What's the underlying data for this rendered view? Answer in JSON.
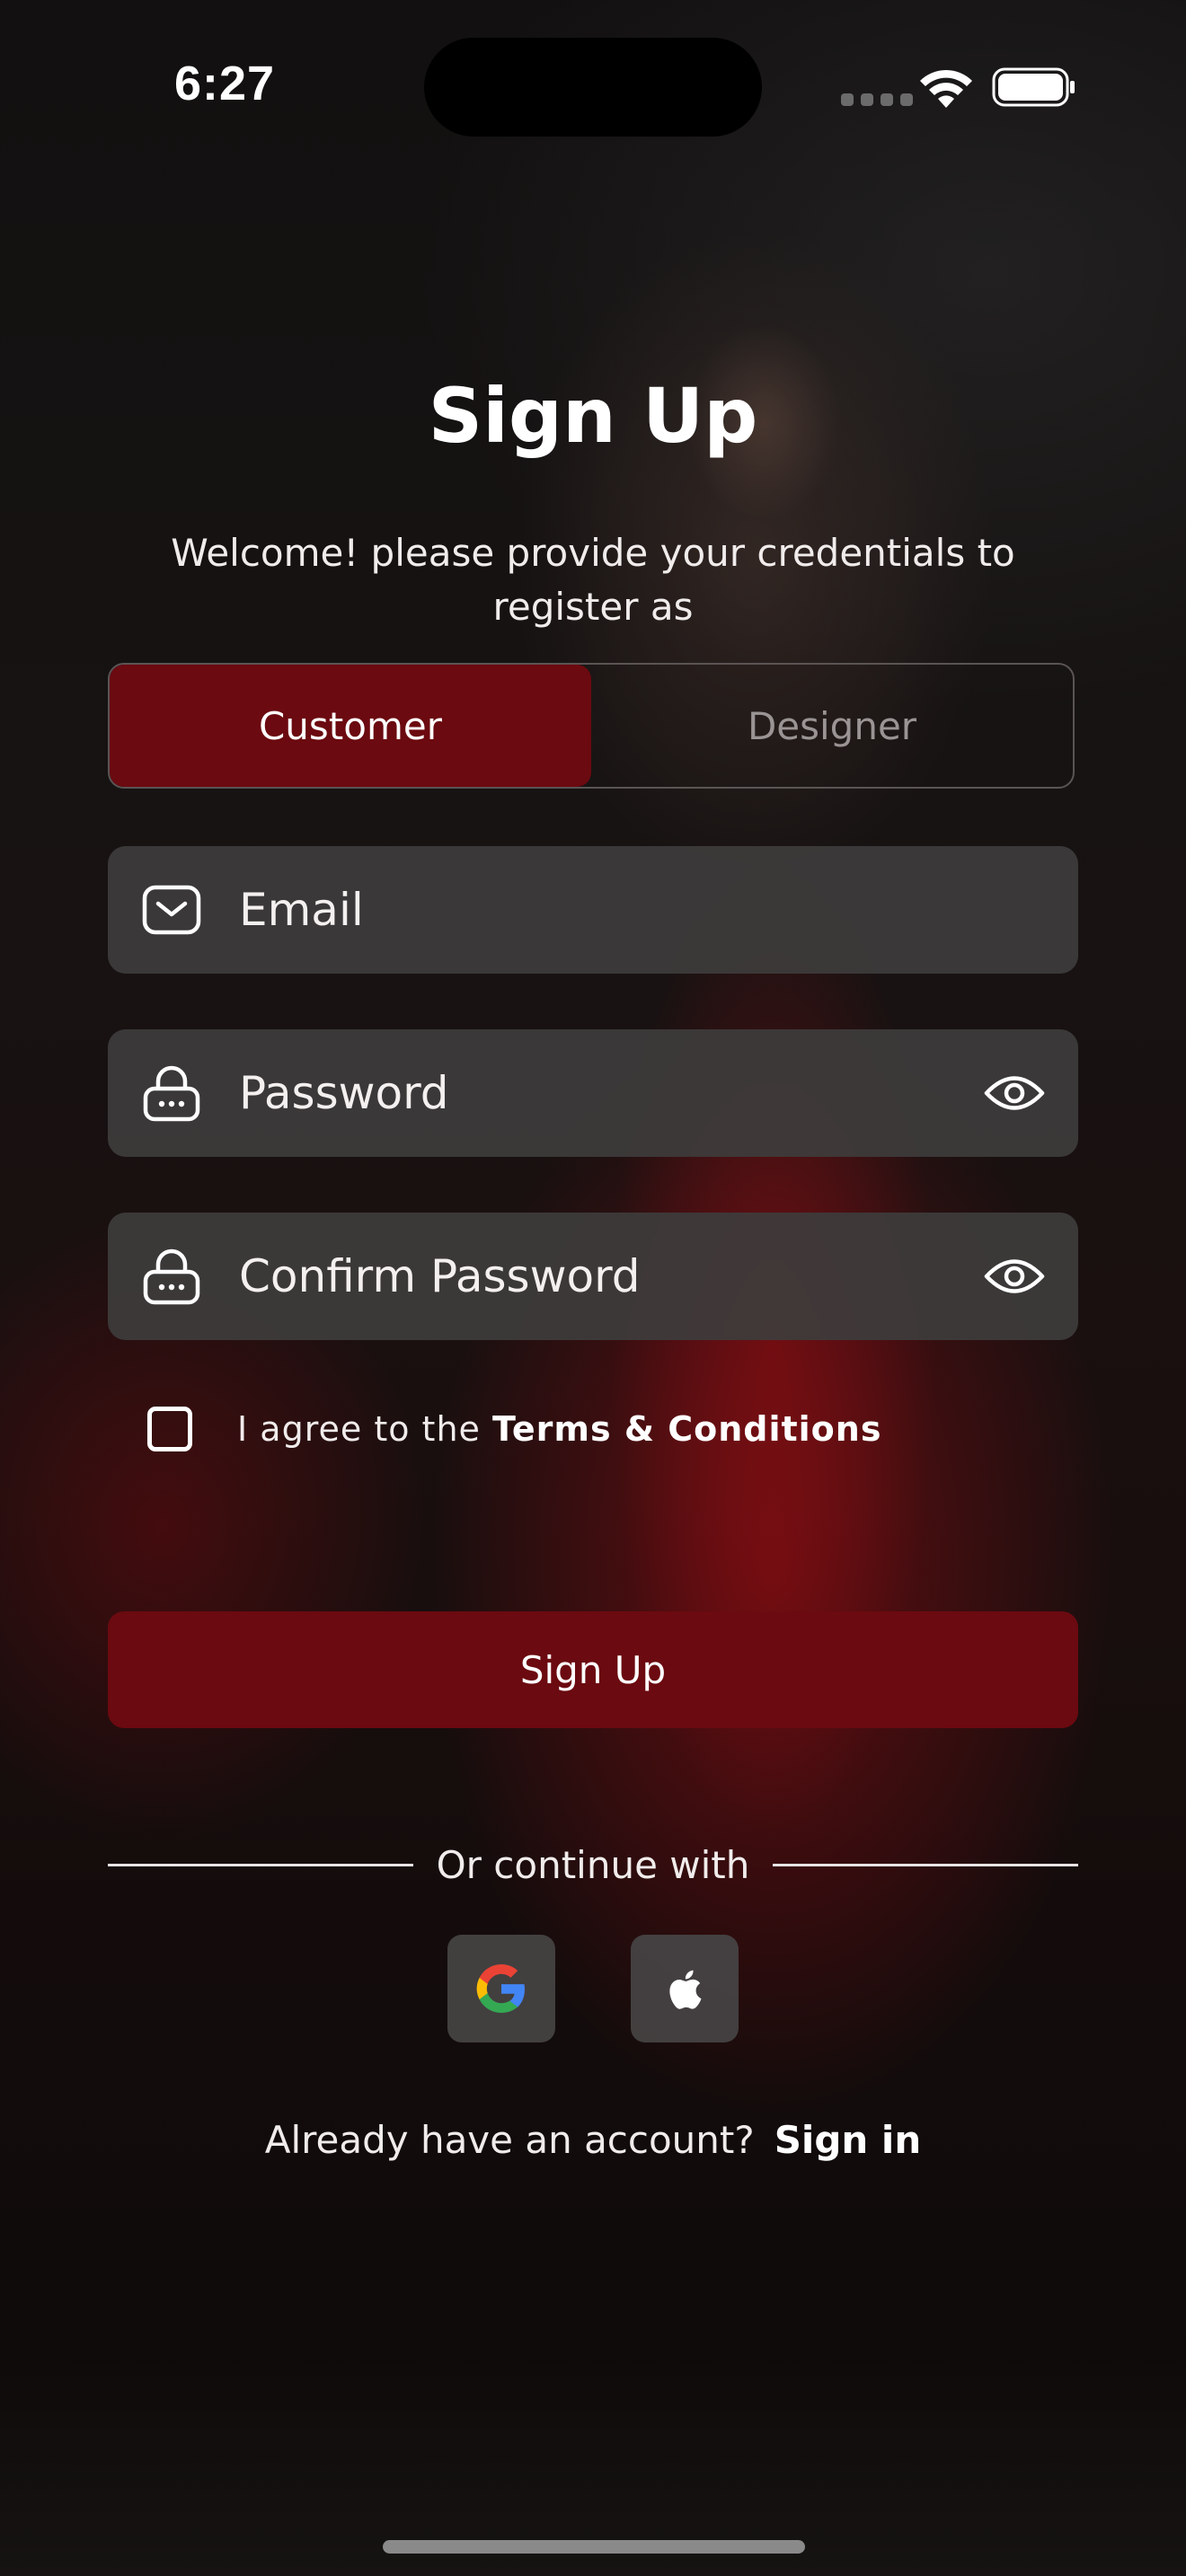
{
  "status_bar": {
    "time": "6:27"
  },
  "header": {
    "title": "Sign Up",
    "subtitle": "Welcome! please provide your credentials to register as"
  },
  "role_toggle": {
    "options": [
      "Customer",
      "Designer"
    ],
    "selected": "Customer"
  },
  "form": {
    "email_placeholder": "Email",
    "password_placeholder": "Password",
    "confirm_password_placeholder": "Confirm Password"
  },
  "terms": {
    "prefix": "I agree to the ",
    "link": "Terms & Conditions",
    "checked": false
  },
  "primary_button": {
    "label": "Sign Up"
  },
  "divider": {
    "label": "Or continue with"
  },
  "social": {
    "providers": [
      "google-icon",
      "apple-icon"
    ]
  },
  "footer": {
    "prompt": "Already have an account?",
    "link": "Sign in"
  },
  "colors": {
    "accent": "#6b0a10",
    "field_bg": "#3e3c3c",
    "text": "#ffffff"
  }
}
